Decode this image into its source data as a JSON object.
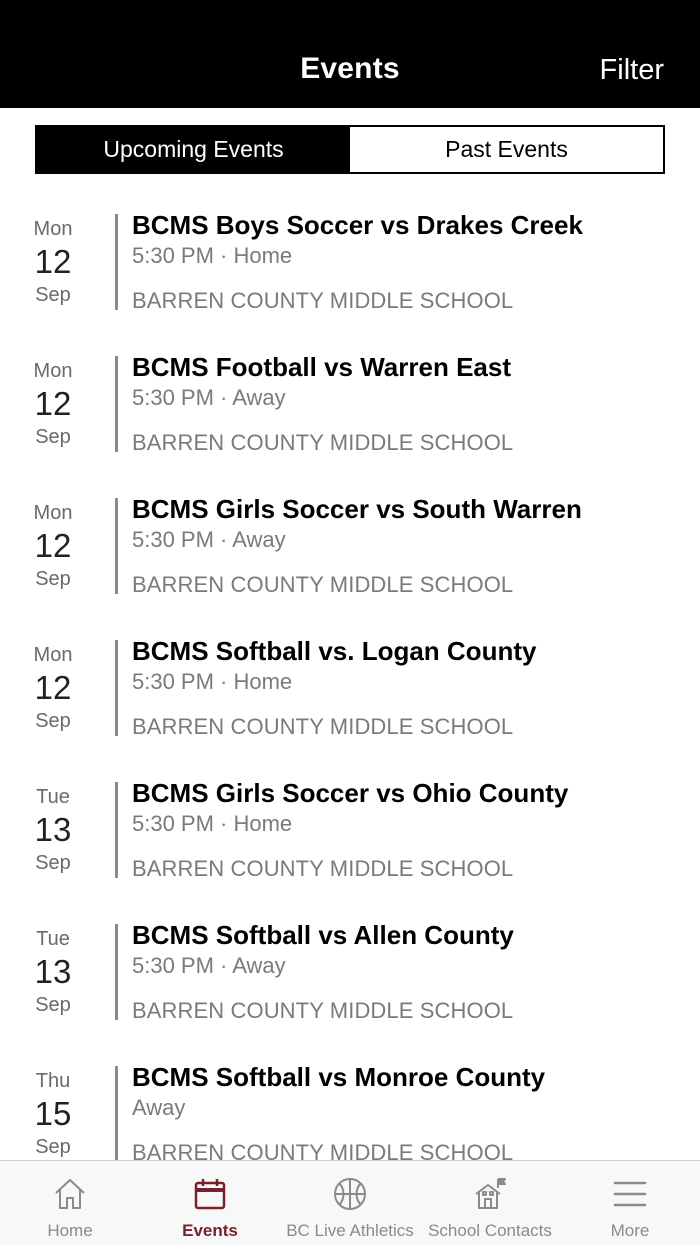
{
  "header": {
    "title": "Events",
    "filter_label": "Filter"
  },
  "segments": {
    "upcoming": "Upcoming Events",
    "past": "Past Events"
  },
  "events": [
    {
      "dow": "Mon",
      "day": "12",
      "month": "Sep",
      "title": "BCMS Boys Soccer vs Drakes Creek",
      "time": "5:30 PM · Home",
      "school": "BARREN COUNTY MIDDLE SCHOOL"
    },
    {
      "dow": "Mon",
      "day": "12",
      "month": "Sep",
      "title": "BCMS Football vs Warren East",
      "time": "5:30 PM · Away",
      "school": "BARREN COUNTY MIDDLE SCHOOL"
    },
    {
      "dow": "Mon",
      "day": "12",
      "month": "Sep",
      "title": "BCMS Girls Soccer vs South Warren",
      "time": "5:30 PM · Away",
      "school": "BARREN COUNTY MIDDLE SCHOOL"
    },
    {
      "dow": "Mon",
      "day": "12",
      "month": "Sep",
      "title": "BCMS Softball vs. Logan County",
      "time": "5:30 PM · Home",
      "school": "BARREN COUNTY MIDDLE SCHOOL"
    },
    {
      "dow": "Tue",
      "day": "13",
      "month": "Sep",
      "title": "BCMS Girls Soccer vs Ohio County",
      "time": "5:30 PM · Home",
      "school": "BARREN COUNTY MIDDLE SCHOOL"
    },
    {
      "dow": "Tue",
      "day": "13",
      "month": "Sep",
      "title": "BCMS Softball vs Allen County",
      "time": "5:30 PM · Away",
      "school": "BARREN COUNTY MIDDLE SCHOOL"
    },
    {
      "dow": "Thu",
      "day": "15",
      "month": "Sep",
      "title": "BCMS Softball vs Monroe County",
      "time": "Away",
      "school": "BARREN COUNTY MIDDLE SCHOOL"
    }
  ],
  "tabbar": {
    "home": {
      "label": "Home",
      "icon": "home-icon"
    },
    "events": {
      "label": "Events",
      "icon": "calendar-icon"
    },
    "live": {
      "label": "BC Live Athletics",
      "icon": "basketball-icon"
    },
    "contacts": {
      "label": "School Contacts",
      "icon": "school-icon"
    },
    "more": {
      "label": "More",
      "icon": "menu-icon"
    }
  },
  "colors": {
    "accent": "#7a1f2b",
    "header_bg": "#000000",
    "inactive_tab": "#8a8a8a"
  }
}
